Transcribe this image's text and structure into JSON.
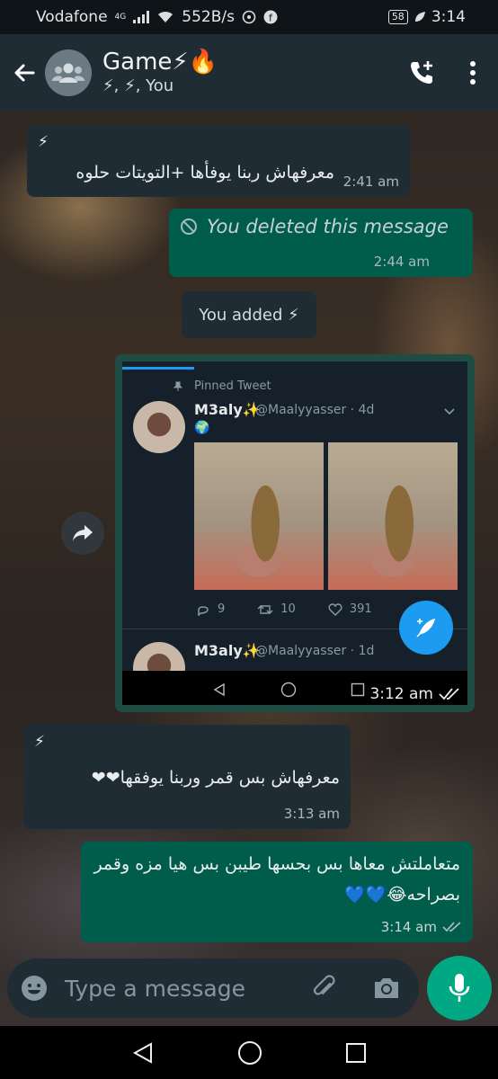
{
  "status_bar": {
    "carrier": "Vodafone",
    "network": "4G",
    "speed": "552B/s",
    "battery": "58",
    "time": "3:14"
  },
  "header": {
    "title": "Game⚡🔥",
    "subtitle": "⚡, ⚡, You",
    "avatar_icon": "group-avatar-icon",
    "back_icon": "arrow-back-icon",
    "call_icon": "add-call-icon",
    "menu_icon": "more-vertical-icon"
  },
  "messages": [
    {
      "id": "m1",
      "direction": "in",
      "sender": "⚡",
      "text": "معرفهاش ربنا يوفأها +التويتات حلوه",
      "time": "2:41 am"
    },
    {
      "id": "m2",
      "direction": "out",
      "deleted": true,
      "text": "You deleted this message",
      "time": "2:44 am"
    },
    {
      "id": "m3",
      "type": "system",
      "text": "You added ⚡"
    },
    {
      "id": "m4",
      "direction": "in",
      "type": "image",
      "time": "3:12 am",
      "screenshot": {
        "pinned_label": "Pinned Tweet",
        "tweet1_name": "M3aly✨",
        "tweet1_handle": "@Maalyyasser · 4d",
        "tweet1_emoji": "🌍",
        "replies": "9",
        "retweets": "10",
        "likes": "391",
        "tweet2_name": "M3aly✨",
        "tweet2_handle": "@Maalyyasser · 1d"
      }
    },
    {
      "id": "m5",
      "direction": "in",
      "sender": "⚡",
      "text": "معرفهاش بس قمر وربنا يوفقها❤❤",
      "time": "3:13 am"
    },
    {
      "id": "m6",
      "direction": "out",
      "text": "متعاملتش معاها بس بحسها طيبن بس هيا مزه وقمر بصراحه😂💙💙",
      "time": "3:14 am"
    }
  ],
  "input": {
    "placeholder": "Type a message"
  },
  "colors": {
    "header": "#1f2c34",
    "incoming": "#1f2c34",
    "outgoing": "#005c4b",
    "accent": "#00a884"
  }
}
